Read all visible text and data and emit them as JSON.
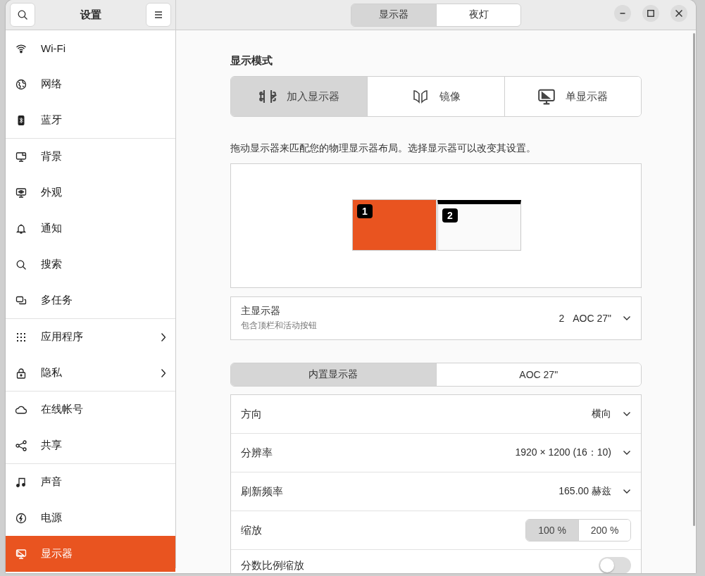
{
  "window": {
    "title": "设置"
  },
  "header_tabs": [
    {
      "label": "显示器",
      "selected": true
    },
    {
      "label": "夜灯",
      "selected": false
    }
  ],
  "sidebar": {
    "groups": [
      [
        {
          "label": "Wi-Fi",
          "selected": false
        },
        {
          "label": "网络",
          "selected": false
        },
        {
          "label": "蓝牙",
          "selected": false
        }
      ],
      [
        {
          "label": "背景",
          "selected": false
        },
        {
          "label": "外观",
          "selected": false
        },
        {
          "label": "通知",
          "selected": false
        },
        {
          "label": "搜索",
          "selected": false
        },
        {
          "label": "多任务",
          "selected": false
        }
      ],
      [
        {
          "label": "应用程序",
          "selected": false,
          "submenu": true
        },
        {
          "label": "隐私",
          "selected": false,
          "submenu": true
        }
      ],
      [
        {
          "label": "在线帐号",
          "selected": false
        },
        {
          "label": "共享",
          "selected": false
        }
      ],
      [
        {
          "label": "声音",
          "selected": false
        },
        {
          "label": "电源",
          "selected": false
        },
        {
          "label": "显示器",
          "selected": true
        }
      ]
    ]
  },
  "display_mode": {
    "title": "显示模式",
    "options": [
      {
        "label": "加入显示器",
        "selected": true
      },
      {
        "label": "镜像",
        "selected": false
      },
      {
        "label": "单显示器",
        "selected": false
      }
    ]
  },
  "arrangement": {
    "hint": "拖动显示器来匹配您的物理显示器布局。选择显示器可以改变其设置。",
    "monitors": [
      {
        "number": "1",
        "selected": true,
        "primary": false
      },
      {
        "number": "2",
        "selected": false,
        "primary": true
      }
    ]
  },
  "primary_display": {
    "label": "主显示器",
    "sublabel": "包含顶栏和活动按钮",
    "number": "2",
    "value": "AOC 27\""
  },
  "display_tabs": [
    {
      "label": "内置显示器",
      "selected": true
    },
    {
      "label": "AOC 27\"",
      "selected": false
    }
  ],
  "settings": [
    {
      "kind": "dropdown",
      "label": "方向",
      "value": "横向"
    },
    {
      "kind": "dropdown",
      "label": "分辨率",
      "value": "1920 × 1200 (16：10)"
    },
    {
      "kind": "dropdown",
      "label": "刷新频率",
      "value": "165.00 赫兹"
    },
    {
      "kind": "segmented",
      "label": "缩放",
      "options": [
        {
          "label": "100 %",
          "selected": true
        },
        {
          "label": "200 %",
          "selected": false
        }
      ]
    },
    {
      "kind": "switch",
      "label": "分数比例缩放",
      "on": false
    }
  ]
}
